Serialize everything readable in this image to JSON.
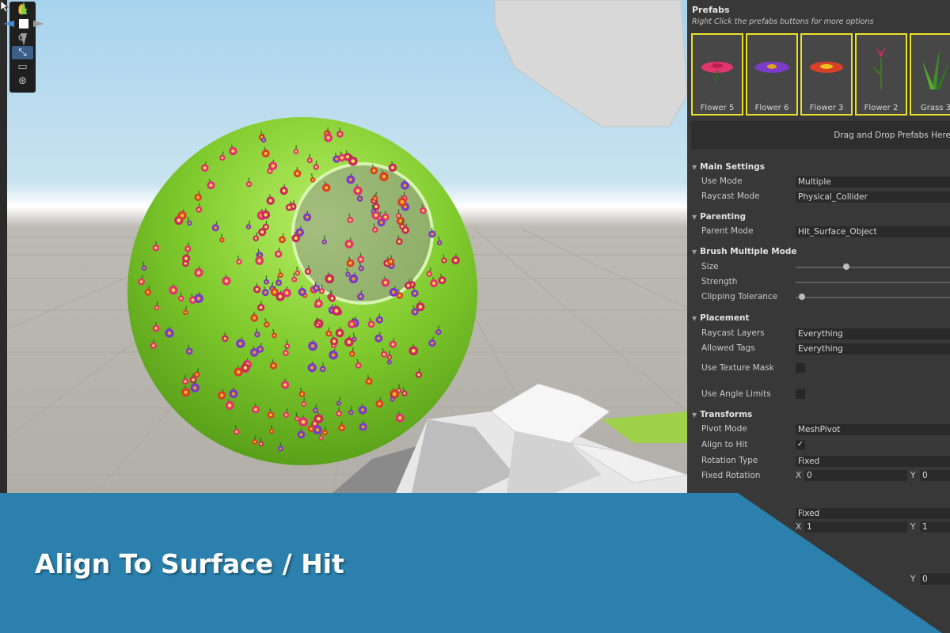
{
  "banner": {
    "title": "Align To Surface / Hit",
    "color": "#2b80ad"
  },
  "toolbar": {
    "tools": [
      {
        "icon": "hand-icon",
        "glyph": "✋"
      },
      {
        "icon": "move-icon",
        "glyph": "✥"
      },
      {
        "icon": "rotate-icon",
        "glyph": "⟳"
      },
      {
        "icon": "scale-icon",
        "glyph": "⤡"
      },
      {
        "icon": "rect-icon",
        "glyph": "▭"
      },
      {
        "icon": "transform-icon",
        "glyph": "⊛"
      }
    ],
    "active_index": 3
  },
  "panel": {
    "title": "Prefabs",
    "subtitle": "Right Click the prefabs buttons for more options",
    "prefabs": [
      "Flower 5",
      "Flower 6",
      "Flower 3",
      "Flower 2",
      "Grass 3"
    ],
    "dropzone": "Drag and Drop Prefabs Here",
    "main_settings": {
      "header": "Main Settings",
      "use_mode_label": "Use Mode",
      "use_mode_value": "Multiple",
      "raycast_mode_label": "Raycast Mode",
      "raycast_mode_value": "Physical_Collider"
    },
    "parenting": {
      "header": "Parenting",
      "parent_mode_label": "Parent Mode",
      "parent_mode_value": "Hit_Surface_Object"
    },
    "brush": {
      "header": "Brush Multiple Mode",
      "size_label": "Size",
      "strength_label": "Strength",
      "clipping_label": "Clipping Tolerance",
      "size_level": 0.32,
      "clipping_level": 0.02
    },
    "placement": {
      "header": "Placement",
      "raycast_layers_label": "Raycast Layers",
      "raycast_layers_value": "Everything",
      "allowed_tags_label": "Allowed Tags",
      "allowed_tags_value": "Everything",
      "texture_mask_label": "Use Texture Mask",
      "angle_limits_label": "Use Angle Limits"
    },
    "transforms": {
      "header": "Transforms",
      "pivot_mode_label": "Pivot Mode",
      "pivot_mode_value": "MeshPivot",
      "align_label": "Align to Hit",
      "align_checked": "✓",
      "rotation_type_label": "Rotation Type",
      "rotation_type_value": "Fixed",
      "fixed_rotation_label": "Fixed Rotation",
      "rot_x_axis": "X",
      "rot_x": "0",
      "rot_y_axis": "Y",
      "rot_y": "0",
      "scale_type_value": "Fixed",
      "scale_x_axis": "X",
      "scale_x": "1",
      "scale_y_axis": "Y",
      "scale_y": "1",
      "extra_y_axis": "Y",
      "extra_y": "0"
    }
  }
}
